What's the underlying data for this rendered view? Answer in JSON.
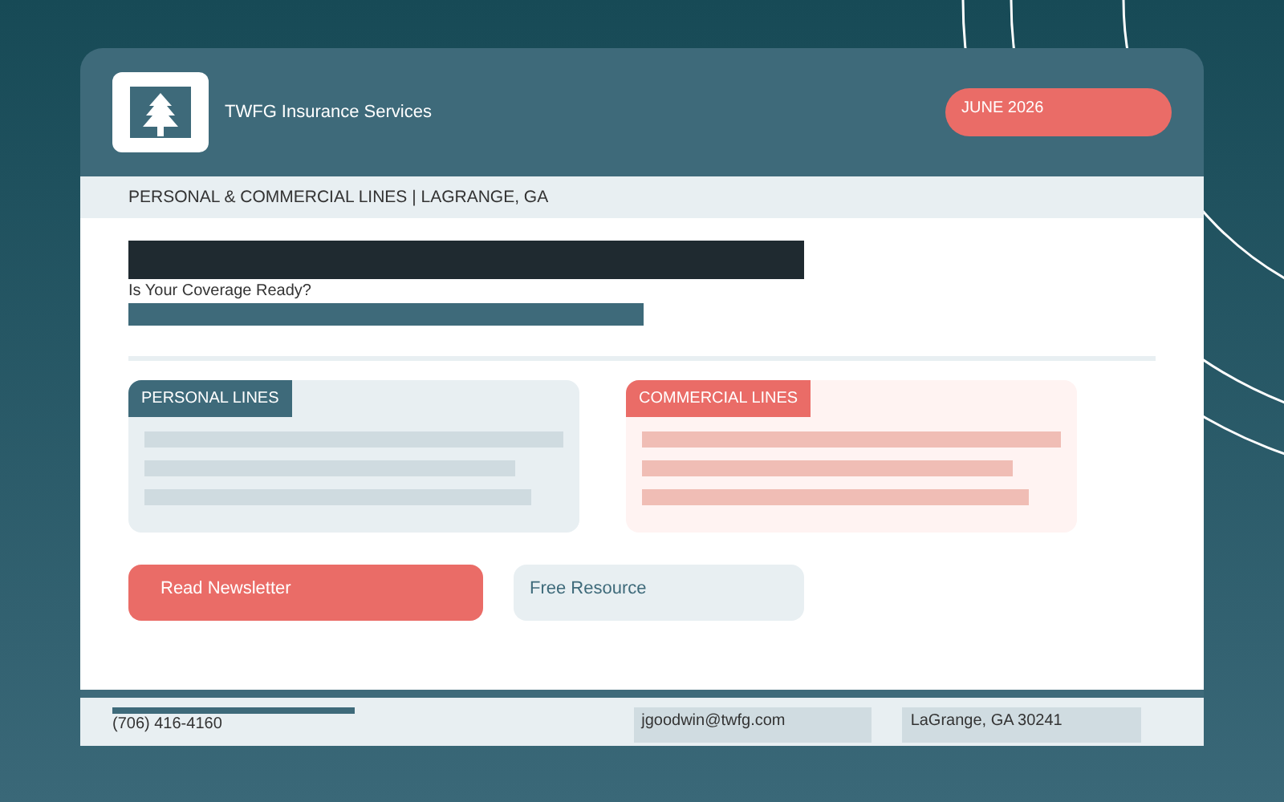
{
  "header": {
    "logo_title": "TWFG Insurance Services",
    "date_badge": "JUNE 2026"
  },
  "subheader": {
    "tagline": "PERSONAL & COMMERCIAL LINES | LAGRANGE, GA"
  },
  "hero": {
    "headline": "Is Your Coverage Ready?"
  },
  "cards": [
    {
      "label": "PERSONAL LINES",
      "kind": "personal"
    },
    {
      "label": "COMMERCIAL LINES",
      "kind": "commercial"
    }
  ],
  "buttons": [
    {
      "label": "Read Newsletter",
      "kind": "primary"
    },
    {
      "label": "Free Resource",
      "kind": "secondary"
    }
  ],
  "footer": {
    "phone": "(706) 416-4160",
    "email": "jgoodwin@twfg.com",
    "address": "LaGrange, GA 30241"
  }
}
